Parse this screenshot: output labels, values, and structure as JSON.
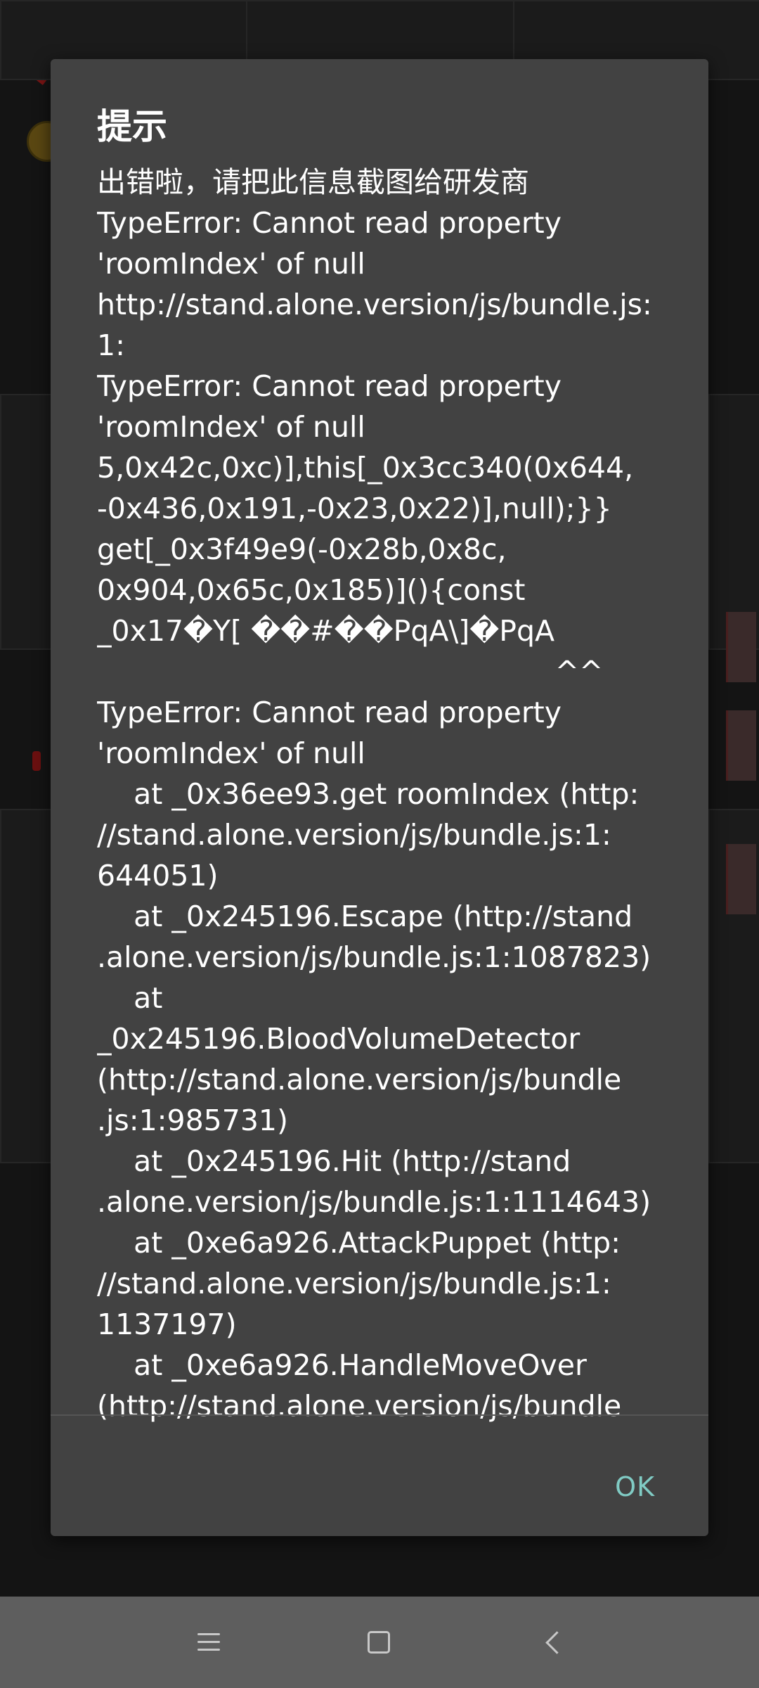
{
  "dialog": {
    "title": "提示",
    "lines": [
      "出错啦，请把此信息截图给研发商",
      "TypeError: Cannot read property",
      "'roomIndex' of null",
      "http://stand.alone.version/js/bundle.js:",
      "1:",
      "TypeError: Cannot read property",
      "'roomIndex' of null",
      "5,0x42c,0xc)],this[_0x3cc340(0x644,",
      "-0x436,0x191,-0x23,0x22)],null);}}",
      "get[_0x3f49e9(-0x28b,0x8c,",
      "0x904,0x65c,0x185)](){const",
      "_0x17�Y[ ��#��PqA\\]�PqA",
      "                                                  ^^",
      "TypeError: Cannot read property",
      "'roomIndex' of null",
      "    at _0x36ee93.get roomIndex (http:",
      "//stand.alone.version/js/bundle.js:1:",
      "644051)",
      "    at _0x245196.Escape (http://stand",
      ".alone.version/js/bundle.js:1:1087823)",
      "    at",
      "_0x245196.BloodVolumeDetector",
      "(http://stand.alone.version/js/bundle",
      ".js:1:985731)",
      "    at _0x245196.Hit (http://stand",
      ".alone.version/js/bundle.js:1:1114643)",
      "    at _0xe6a926.AttackPuppet (http:",
      "//stand.alone.version/js/bundle.js:1:",
      "1137197)",
      "    at _0xe6a926.HandleMoveOver",
      "(http://stand.alone.version/js/bundle"
    ],
    "ok_label": "OK"
  },
  "navbar": {
    "menu_icon": "menu-lines-icon",
    "home_icon": "home-square-icon",
    "back_icon": "back-chevron-icon"
  },
  "colors": {
    "dialog_bg": "#424242",
    "ok_accent": "#80cbc4",
    "navbar_bg": "#5e5e5e"
  }
}
